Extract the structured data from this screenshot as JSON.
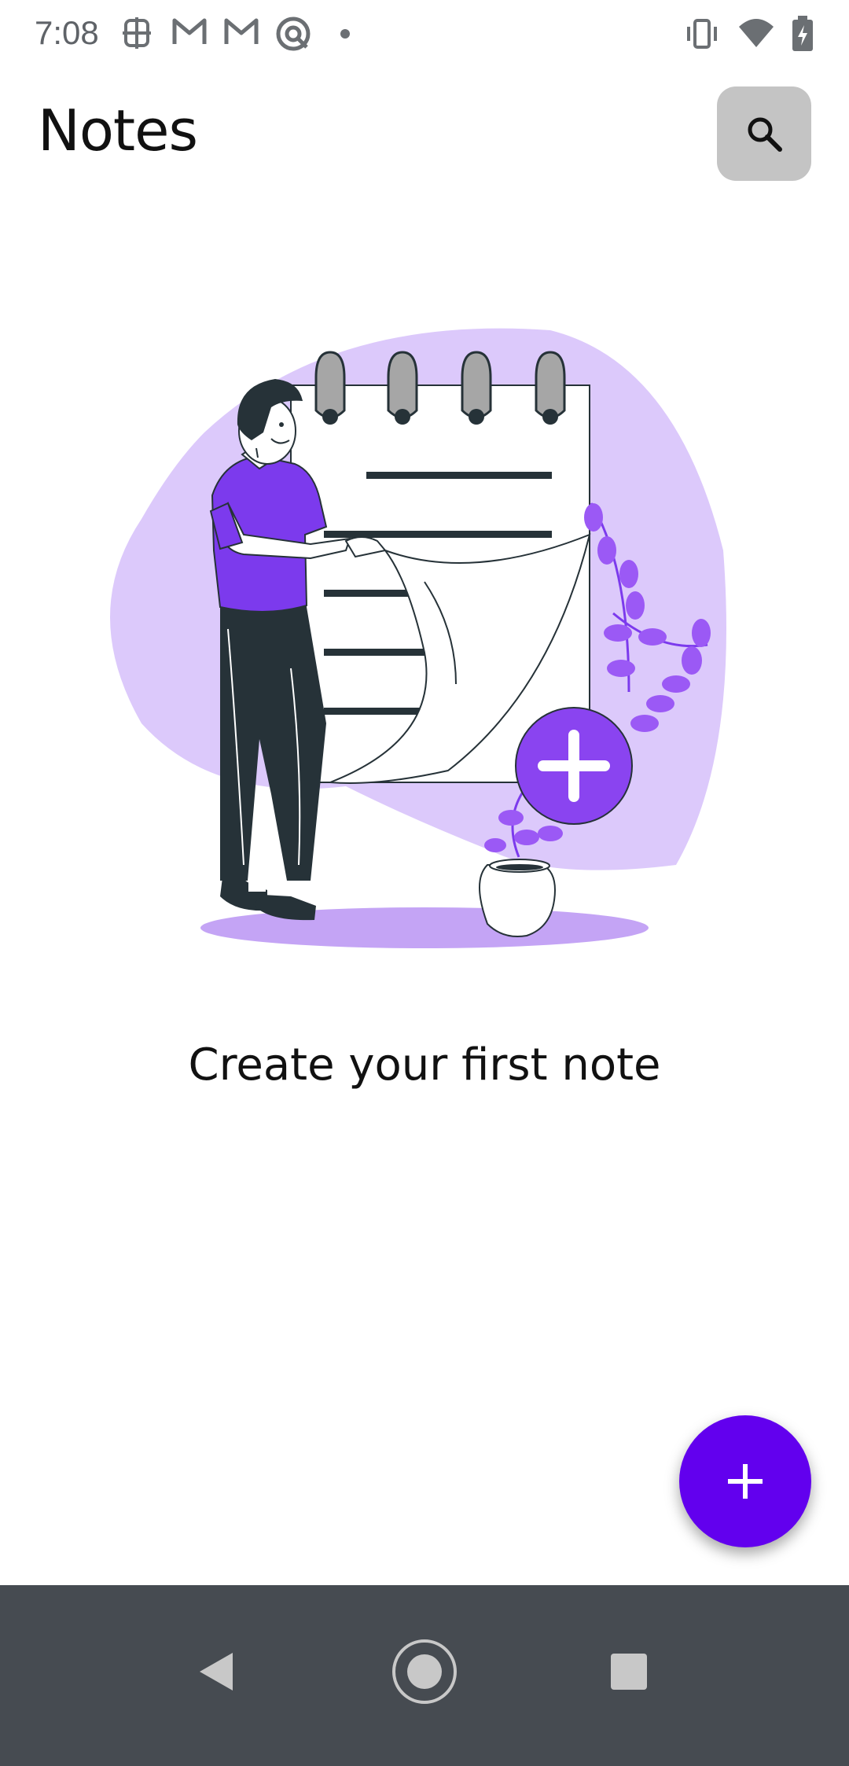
{
  "status_bar": {
    "time": "7:08",
    "left_icons": [
      "grid-notification-icon",
      "gmail-icon",
      "gmail-icon",
      "at-sign-icon",
      "dot-icon"
    ],
    "right_icons": [
      "vibrate-icon",
      "wifi-icon",
      "battery-charging-icon"
    ]
  },
  "header": {
    "title": "Notes",
    "search_icon": "search-icon"
  },
  "illustration": {
    "subject": "person-with-notepad-illustration",
    "accent_color": "#7c3aed",
    "blob_color": "#dcc9fb"
  },
  "empty_state": {
    "message": "Create your first note"
  },
  "fab": {
    "icon": "plus-icon",
    "color": "#6200ee"
  },
  "navigation": {
    "back_icon": "back-icon",
    "home_icon": "home-icon",
    "recents_icon": "recents-icon",
    "bar_color": "#464b51"
  }
}
